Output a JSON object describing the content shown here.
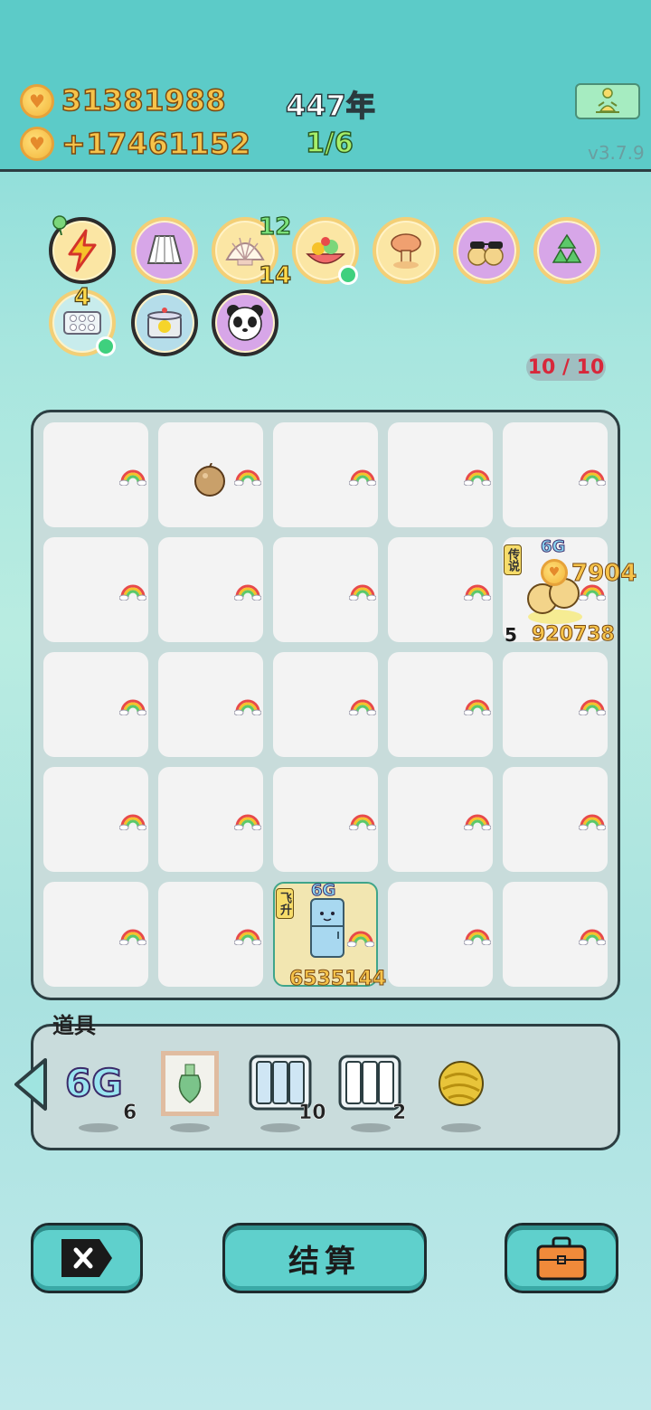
{
  "header": {
    "coins": "31381988",
    "income": "+17461152",
    "year": "447年",
    "progress": "1/6",
    "version": "v3.7.9"
  },
  "skills": {
    "shell_top_count": "12",
    "shell_bottom_count": "14",
    "tray_count": "4"
  },
  "board": {
    "counter": "10 / 10",
    "legend_tag": "传说",
    "legend_gen": "6G",
    "legend_income": "7904",
    "legend_level": "5",
    "legend_value": "920738",
    "fridge_tag": "飞升",
    "fridge_gen": "6G",
    "fridge_value": "6535144"
  },
  "items": {
    "title": "道具",
    "g_label": "6G",
    "g_count": "6",
    "bottles_count": "10",
    "slots_count": "2"
  },
  "buttons": {
    "settle": "结算"
  },
  "colors": {
    "topbar": "#5ccbc8",
    "gold_text": "#f6c34a",
    "counter_text": "#d8273a"
  }
}
